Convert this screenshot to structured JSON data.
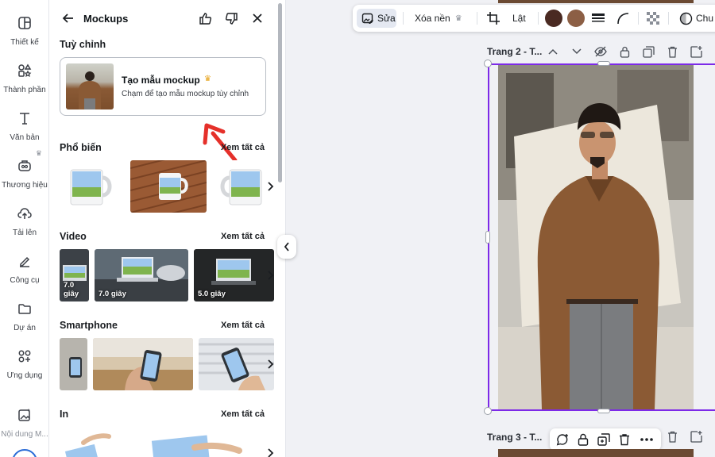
{
  "rail": {
    "items": [
      {
        "label": "Thiết kế",
        "icon": "layout-icon"
      },
      {
        "label": "Thành phần",
        "icon": "elements-icon"
      },
      {
        "label": "Văn bản",
        "icon": "text-icon"
      },
      {
        "label": "Thương hiệu",
        "icon": "brand-icon"
      },
      {
        "label": "Tải lên",
        "icon": "upload-icon"
      },
      {
        "label": "Công cụ",
        "icon": "draw-tool-icon"
      },
      {
        "label": "Dự án",
        "icon": "folder-icon"
      },
      {
        "label": "Ứng dụng",
        "icon": "apps-icon"
      },
      {
        "label": "Nội dung M...",
        "icon": "magic-media-icon"
      }
    ]
  },
  "panel": {
    "title": "Mockups",
    "custom_section": {
      "title": "Tuỳ chỉnh",
      "card_title": "Tạo mẫu mockup",
      "card_subtitle": "Chạm để tạo mẫu mockup tùy chỉnh"
    },
    "sections": [
      {
        "title": "Phổ biến",
        "see_all": "Xem tất cả"
      },
      {
        "title": "Video",
        "see_all": "Xem tất cả",
        "durations": [
          "7.0 giây",
          "7.0 giây",
          "5.0 giây"
        ]
      },
      {
        "title": "Smartphone",
        "see_all": "Xem tất cả"
      },
      {
        "title": "In",
        "see_all": "Xem tất cả"
      }
    ]
  },
  "toolbar": {
    "edit_label": "Sửa",
    "remove_bg_label": "Xóa nền",
    "flip_label": "Lật",
    "cut_label": "Chu",
    "colors": [
      "#4a2a22",
      "#8c5f45"
    ]
  },
  "canvas": {
    "page2_label": "Trang 2 - T...",
    "page3_label": "Trang 3 - T..."
  }
}
